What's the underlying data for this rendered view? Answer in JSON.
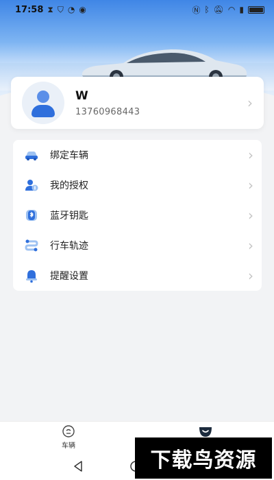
{
  "status_bar": {
    "time": "17:58",
    "left_icons": [
      "hourglass-icon",
      "shield-icon",
      "speedometer-icon",
      "eye-icon"
    ],
    "right_icons": [
      "nfc-icon",
      "bluetooth-icon",
      "mute-icon",
      "wifi-icon",
      "sim-icon",
      "battery-icon"
    ]
  },
  "profile": {
    "name": "W",
    "phone": "13760968443"
  },
  "menu": {
    "items": [
      {
        "label": "绑定车辆",
        "icon": "car-icon"
      },
      {
        "label": "我的授权",
        "icon": "user-authorize-icon"
      },
      {
        "label": "蓝牙钥匙",
        "icon": "bluetooth-key-icon"
      },
      {
        "label": "行车轨迹",
        "icon": "route-icon"
      },
      {
        "label": "提醒设置",
        "icon": "bell-icon"
      }
    ]
  },
  "tabbar": {
    "tabs": [
      {
        "label": "车辆",
        "icon": "vehicle-tab-icon"
      },
      {
        "label": "",
        "icon": "profile-tab-icon"
      }
    ]
  },
  "watermark": {
    "text": "下载鸟资源"
  },
  "colors": {
    "accent": "#2f6fdc",
    "icon_light": "#9ec2f2"
  }
}
